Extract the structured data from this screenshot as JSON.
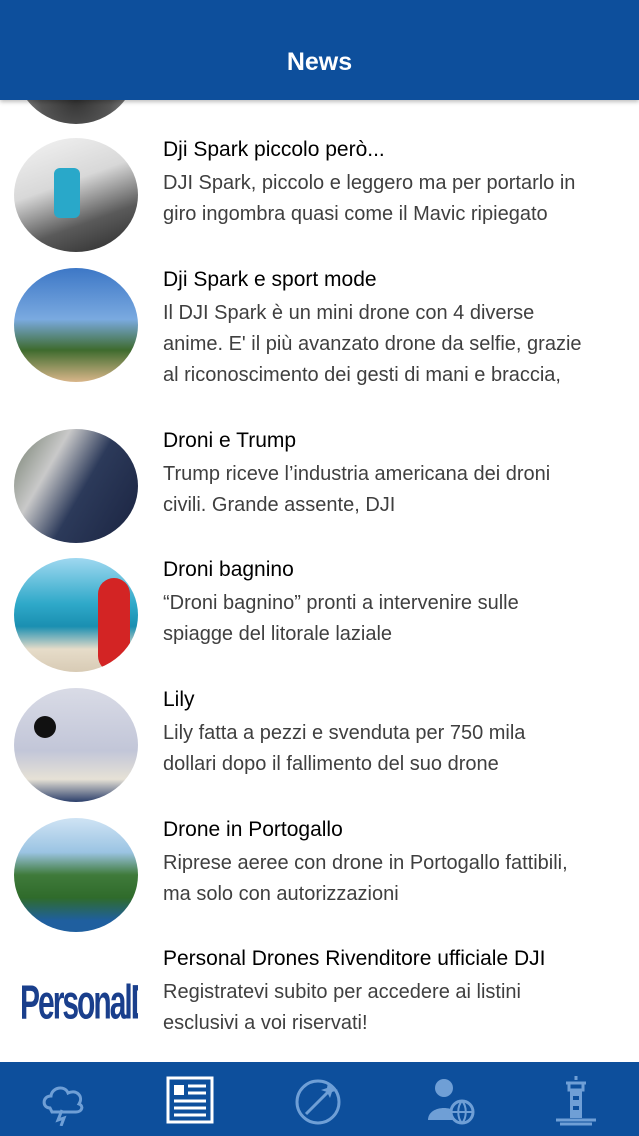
{
  "header": {
    "title": "News"
  },
  "news": [
    {
      "title": "Dji Spark piccolo però...",
      "description": "DJI Spark, piccolo e leggero ma per portarlo in\ngiro ingombra quasi come il Mavic ripiegato"
    },
    {
      "title": "Dji Spark e sport mode",
      "description": "Il DJI Spark è un mini drone con 4 diverse\nanime. E' il più avanzato drone da selfie, grazie\nal riconoscimento dei gesti di mani e braccia,"
    },
    {
      "title": "Droni e Trump",
      "description": "Trump riceve l’industria americana dei droni\ncivili. Grande assente, DJI"
    },
    {
      "title": "Droni bagnino",
      "description": "“Droni bagnino” pronti a intervenire sulle\nspiagge del litorale laziale"
    },
    {
      "title": "Lily",
      "description": "Lily fatta a pezzi e svenduta per 750 mila\ndollari dopo il fallimento del suo drone"
    },
    {
      "title": "Drone in Portogallo",
      "description": "Riprese aeree con drone in Portogallo fattibili,\nma solo con autorizzazioni"
    },
    {
      "title": "Personal Drones Rivenditore ufficiale DJI",
      "description": "Registratevi subito per accedere ai listini\nesclusivi a voi riservati!",
      "thumb_logo": "PersonalDrones"
    }
  ],
  "tabbar": {
    "tabs": [
      {
        "icon": "weather-cloud-icon",
        "active": false
      },
      {
        "icon": "newspaper-icon",
        "active": true
      },
      {
        "icon": "compass-plane-icon",
        "active": false
      },
      {
        "icon": "user-globe-icon",
        "active": false
      },
      {
        "icon": "lighthouse-icon",
        "active": false
      }
    ]
  },
  "colors": {
    "header_bg": "#0d4f9c",
    "tab_icon": "#6f9fd6",
    "tab_icon_active": "#ffffff"
  }
}
